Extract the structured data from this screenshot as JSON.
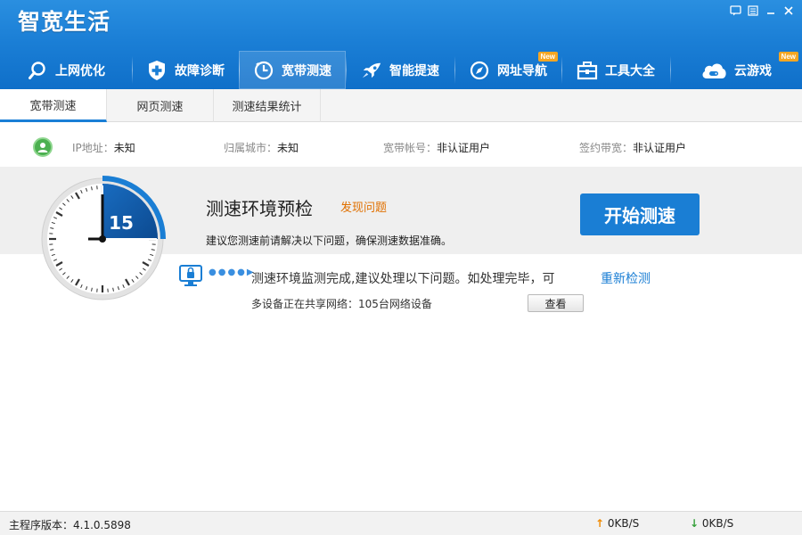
{
  "app": {
    "title": "智宽生活"
  },
  "window_controls": [
    {
      "name": "feedback-icon",
      "glyph": "✉"
    },
    {
      "name": "menu-icon",
      "glyph": "☰"
    },
    {
      "name": "minimize-icon",
      "glyph": "—"
    },
    {
      "name": "close-icon",
      "glyph": "✕"
    }
  ],
  "nav": {
    "items": [
      {
        "label": "上网优化",
        "icon": "search-icon"
      },
      {
        "label": "故障诊断",
        "icon": "shield-plus-icon"
      },
      {
        "label": "宽带测速",
        "icon": "speed-clock-icon",
        "active": true
      },
      {
        "label": "智能提速",
        "icon": "rocket-icon"
      },
      {
        "label": "网址导航",
        "icon": "compass-icon",
        "badge": "New"
      },
      {
        "label": "工具大全",
        "icon": "toolbox-icon"
      },
      {
        "label": "云游戏",
        "icon": "cloud-gamepad-icon",
        "badge": "New"
      }
    ]
  },
  "subtabs": [
    {
      "label": "宽带测速",
      "active": true
    },
    {
      "label": "网页测速"
    },
    {
      "label": "测速结果统计"
    }
  ],
  "info": {
    "ip_label": "IP地址：",
    "ip_value": "未知",
    "city_label": "归属城市：",
    "city_value": "未知",
    "account_label": "宽带帐号：",
    "account_value": "非认证用户",
    "bandwidth_label": "签约带宽：",
    "bandwidth_value": "非认证用户"
  },
  "precheck": {
    "countdown": "15",
    "title": "测速环境预检",
    "issue_link": "发现问题",
    "hint": "建议您测速前请解决以下问题，确保测速数据准确。",
    "start_button": "开始测速"
  },
  "result": {
    "message": "测速环境监测完成,建议处理以下问题。如处理完毕，可",
    "recheck_link": "重新检测",
    "share_text": "多设备正在共享网络：105台网络设备",
    "view_button": "查看"
  },
  "status": {
    "version": "主程序版本：4.1.0.5898",
    "upload": "0KB/S",
    "download": "0KB/S"
  },
  "colors": {
    "brand_blue": "#1b7fd6",
    "accent_orange": "#e07000",
    "link_blue": "#1a7ed4"
  }
}
